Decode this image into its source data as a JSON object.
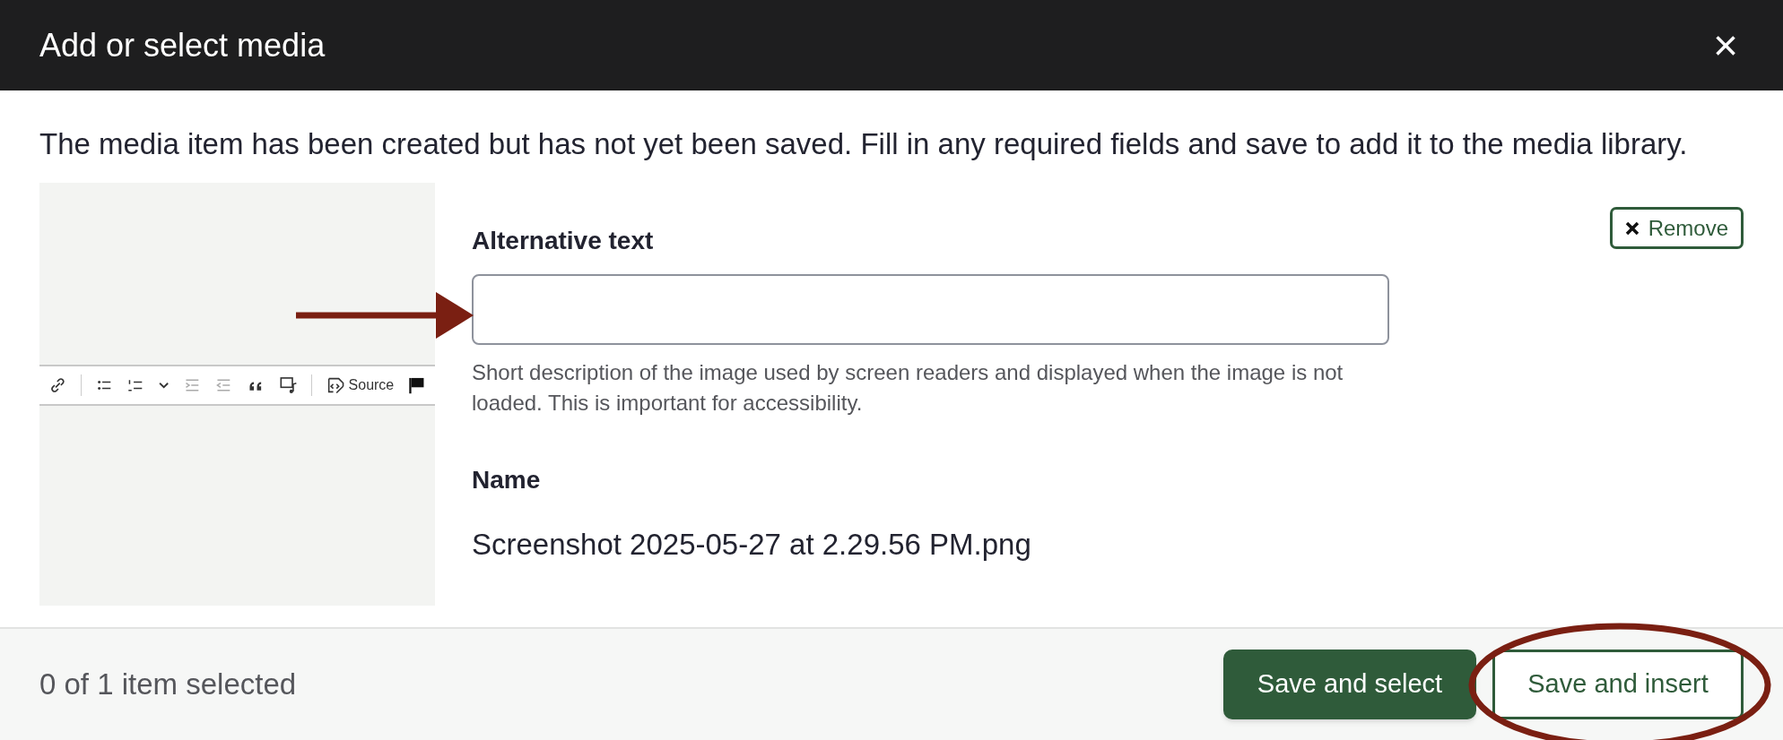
{
  "dialog": {
    "title": "Add or select media",
    "close": "×"
  },
  "message": "The media item has been created but has not yet been saved. Fill in any required fields and save to add it to the media library.",
  "thumbnail": {
    "toolbar": [
      {
        "kind": "link"
      },
      {
        "kind": "divider"
      },
      {
        "kind": "bulleted-list"
      },
      {
        "kind": "numbered-list"
      },
      {
        "kind": "chevron"
      },
      {
        "kind": "indent"
      },
      {
        "kind": "outdent"
      },
      {
        "kind": "quote"
      },
      {
        "kind": "media"
      },
      {
        "kind": "divider"
      },
      {
        "kind": "source",
        "label": "Source"
      },
      {
        "kind": "flag"
      }
    ]
  },
  "remove_button": "Remove",
  "fields": [
    {
      "kind": "input",
      "label": "Alternative text",
      "help": "Short description of the image used by screen readers and displayed when the image is not loaded. This is important for accessibility."
    },
    {
      "kind": "text",
      "label": "Name",
      "value": "Screenshot 2025-05-27 at 2.29.56 PM.png"
    }
  ],
  "footer": {
    "selection": "0 of 1 item selected",
    "buttons": [
      {
        "label": "Save and select",
        "primary": true
      },
      {
        "label": "Save and insert",
        "primary": false
      }
    ]
  }
}
